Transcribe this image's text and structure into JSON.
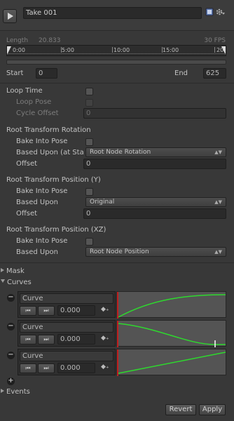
{
  "header": {
    "clip_name": "Take 001"
  },
  "timeline": {
    "length_label": "Length",
    "length_value": "20.833",
    "fps": "30 FPS",
    "ticks": [
      "0:00",
      "5:00",
      "10:00",
      "15:00",
      "20"
    ]
  },
  "range": {
    "start_label": "Start",
    "start_value": "0",
    "end_label": "End",
    "end_value": "625"
  },
  "loop": {
    "loop_time": "Loop Time",
    "loop_pose": "Loop Pose",
    "cycle_offset": "Cycle Offset",
    "cycle_offset_value": "0"
  },
  "root_rotation": {
    "title": "Root Transform Rotation",
    "bake": "Bake Into Pose",
    "based_upon": "Based Upon (at Sta",
    "based_upon_value": "Root Node Rotation",
    "offset": "Offset",
    "offset_value": "0"
  },
  "root_position_y": {
    "title": "Root Transform Position (Y)",
    "bake": "Bake Into Pose",
    "based_upon": "Based Upon",
    "based_upon_value": "Original",
    "offset": "Offset",
    "offset_value": "0"
  },
  "root_position_xz": {
    "title": "Root Transform Position (XZ)",
    "bake": "Bake Into Pose",
    "based_upon": "Based Upon",
    "based_upon_value": "Root Node Position"
  },
  "mask": {
    "label": "Mask"
  },
  "curves": {
    "label": "Curves",
    "items": [
      {
        "name": "Curve",
        "value": "0.000"
      },
      {
        "name": "Curve",
        "value": "0.000"
      },
      {
        "name": "Curve",
        "value": "0.000"
      }
    ]
  },
  "events": {
    "label": "Events"
  },
  "footer": {
    "revert": "Revert",
    "apply": "Apply"
  },
  "colors": {
    "curve": "#2ed82e",
    "marker": "#c02020"
  }
}
